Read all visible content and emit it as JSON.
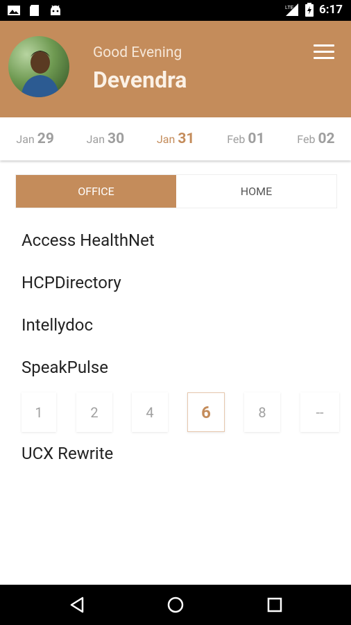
{
  "status_bar": {
    "time": "6:17",
    "icons": [
      "image-icon",
      "sd-card-icon",
      "android-icon",
      "signal-icon",
      "battery-icon"
    ]
  },
  "header": {
    "greeting": "Good Evening",
    "username": "Devendra",
    "background_color": "#c48c5b"
  },
  "dates": [
    {
      "month": "Jan",
      "day": "29",
      "active": false
    },
    {
      "month": "Jan",
      "day": "30",
      "active": false
    },
    {
      "month": "Jan",
      "day": "31",
      "active": true
    },
    {
      "month": "Feb",
      "day": "01",
      "active": false
    },
    {
      "month": "Feb",
      "day": "02",
      "active": false
    }
  ],
  "tabs": {
    "office": "OFFICE",
    "home": "HOME",
    "selected": "OFFICE"
  },
  "projects": [
    "Access HealthNet",
    "HCPDirectory",
    "Intellydoc",
    "SpeakPulse",
    "UCX Rewrite"
  ],
  "hours_picker": {
    "options": [
      "1",
      "2",
      "4",
      "6",
      "8",
      "--"
    ],
    "selected": "6"
  },
  "nav": {
    "icons": [
      "back-icon",
      "home-icon",
      "recents-icon"
    ]
  },
  "colors": {
    "accent": "#c48c5b",
    "text_dark": "#222222",
    "text_muted": "#9e9e9e"
  }
}
